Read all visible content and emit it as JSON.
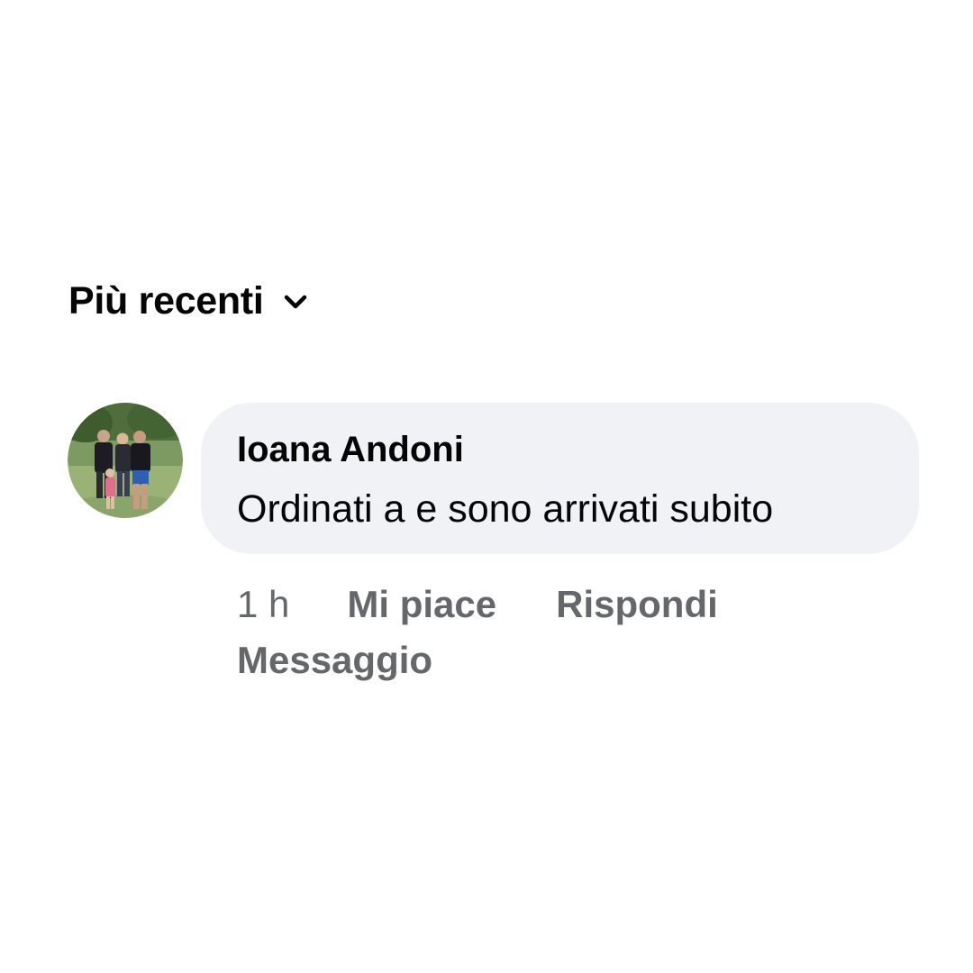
{
  "sort": {
    "label": "Più recenti",
    "icon": "chevron-down-icon"
  },
  "comment": {
    "author": "Ioana Andoni",
    "text": "Ordinati a e sono arrivati subito",
    "avatar_icon": "profile-photo",
    "timestamp": "1 h",
    "actions": {
      "like": "Mi piace",
      "reply": "Rispondi",
      "message": "Messaggio"
    }
  },
  "colors": {
    "bubble_bg": "#f0f2f5",
    "primary_text": "#050505",
    "secondary_text": "#65676b"
  }
}
